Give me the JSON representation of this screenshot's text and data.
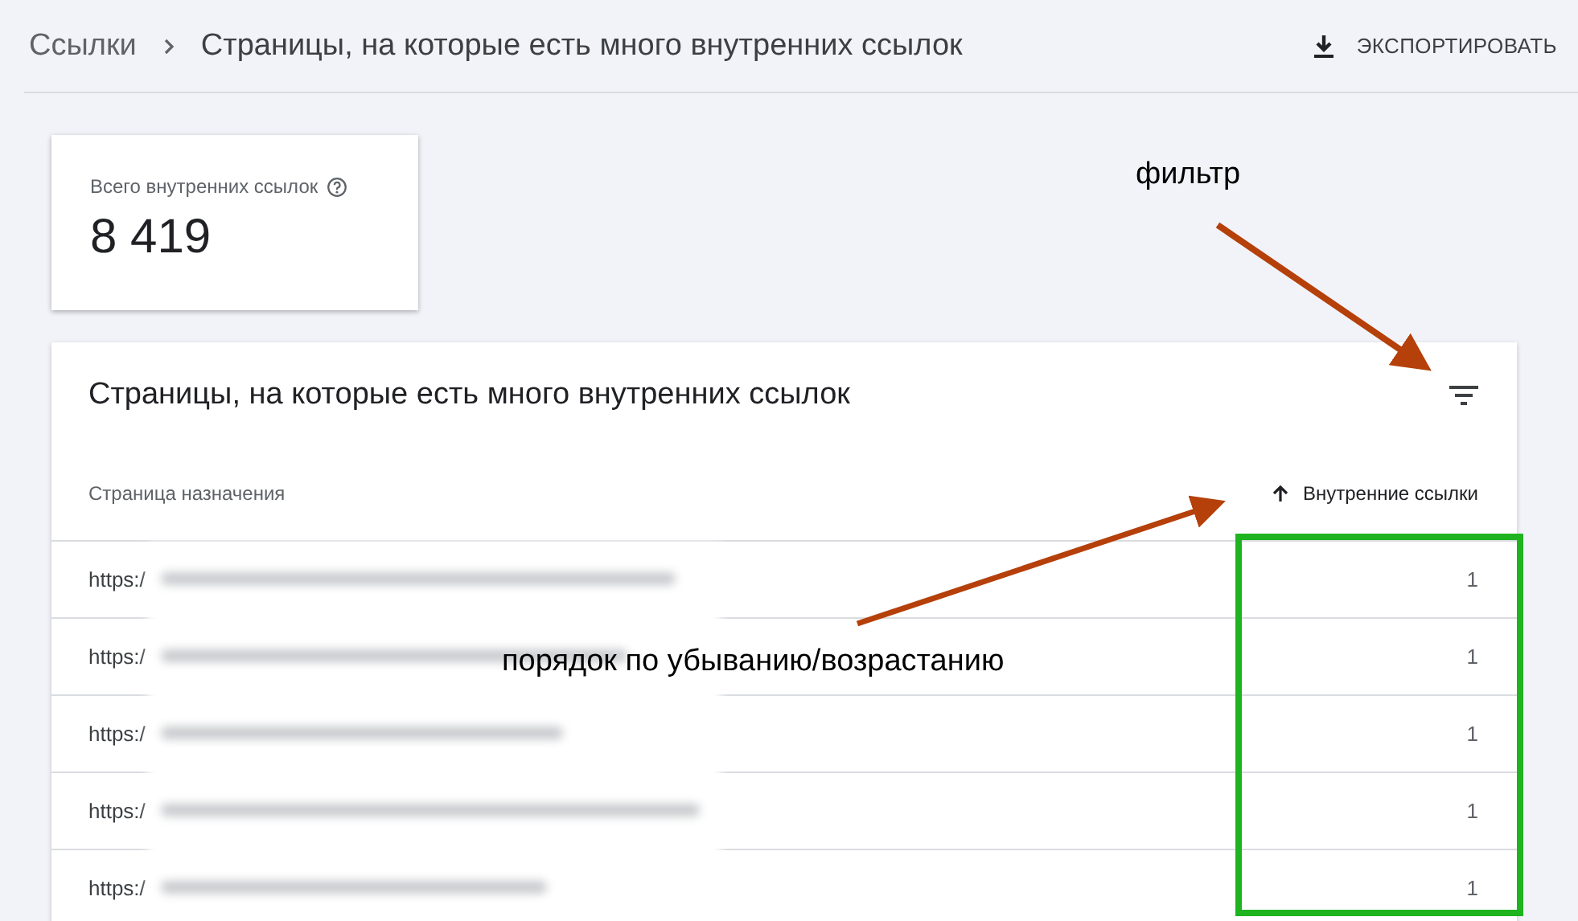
{
  "breadcrumb": [
    {
      "label": "Ссылки"
    },
    {
      "label": "Страницы, на которые есть много внутренних ссылок"
    }
  ],
  "export_button": {
    "label": "ЭКСПОРТИРОВАТЬ"
  },
  "summary_card": {
    "label": "Всего внутренних ссылок",
    "value": "8 419"
  },
  "table": {
    "title": "Страницы, на которые есть много внутренних ссылок",
    "columns": [
      {
        "label": "Страница назначения"
      },
      {
        "label": "Внутренние ссылки",
        "sorted": true,
        "ascending": true
      }
    ],
    "rows": [
      {
        "url": "https:/",
        "count": "1"
      },
      {
        "url": "https:/",
        "count": "1"
      },
      {
        "url": "https:/",
        "count": "1"
      },
      {
        "url": "https:/",
        "count": "1"
      },
      {
        "url": "https:/",
        "count": "1"
      }
    ]
  },
  "annotations": [
    {
      "text": "фильтр"
    },
    {
      "text": "порядок по убыванию/возрастанию"
    }
  ]
}
